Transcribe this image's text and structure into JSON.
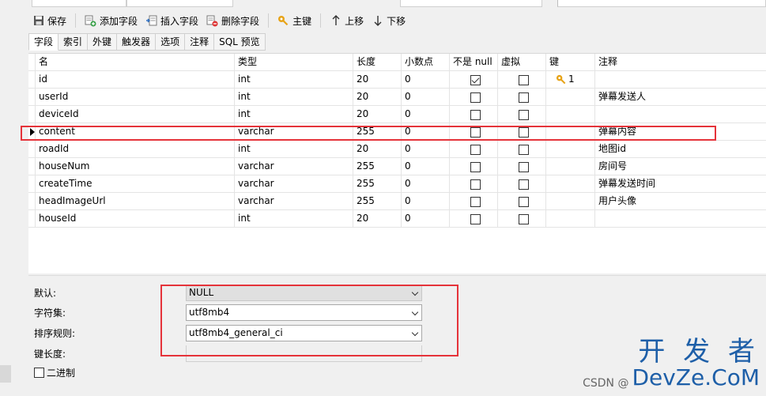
{
  "toolbar": {
    "save": "保存",
    "add_field": "添加字段",
    "insert_field": "插入字段",
    "delete_field": "删除字段",
    "primary_key": "主键",
    "move_up": "上移",
    "move_down": "下移"
  },
  "tabs": [
    "字段",
    "索引",
    "外键",
    "触发器",
    "选项",
    "注释",
    "SQL 预览"
  ],
  "grid": {
    "headers": [
      "名",
      "类型",
      "长度",
      "小数点",
      "不是 null",
      "虚拟",
      "键",
      "注释"
    ],
    "rows": [
      {
        "name": "id",
        "type": "int",
        "length": "20",
        "decimals": "0",
        "not_null": true,
        "virtual": false,
        "key": "1",
        "comment": ""
      },
      {
        "name": "userId",
        "type": "int",
        "length": "20",
        "decimals": "0",
        "not_null": false,
        "virtual": false,
        "key": "",
        "comment": "弹幕发送人"
      },
      {
        "name": "deviceId",
        "type": "int",
        "length": "20",
        "decimals": "0",
        "not_null": false,
        "virtual": false,
        "key": "",
        "comment": ""
      },
      {
        "name": "content",
        "type": "varchar",
        "length": "255",
        "decimals": "0",
        "not_null": false,
        "virtual": false,
        "key": "",
        "comment": "弹幕内容"
      },
      {
        "name": "roadId",
        "type": "int",
        "length": "20",
        "decimals": "0",
        "not_null": false,
        "virtual": false,
        "key": "",
        "comment": "地图id"
      },
      {
        "name": "houseNum",
        "type": "varchar",
        "length": "255",
        "decimals": "0",
        "not_null": false,
        "virtual": false,
        "key": "",
        "comment": "房间号"
      },
      {
        "name": "createTime",
        "type": "varchar",
        "length": "255",
        "decimals": "0",
        "not_null": false,
        "virtual": false,
        "key": "",
        "comment": "弹幕发送时间"
      },
      {
        "name": "headImageUrl",
        "type": "varchar",
        "length": "255",
        "decimals": "0",
        "not_null": false,
        "virtual": false,
        "key": "",
        "comment": "用户头像"
      },
      {
        "name": "houseId",
        "type": "int",
        "length": "20",
        "decimals": "0",
        "not_null": false,
        "virtual": false,
        "key": "",
        "comment": ""
      }
    ]
  },
  "properties": {
    "default_label": "默认:",
    "default_value": "NULL",
    "charset_label": "字符集:",
    "charset_value": "utf8mb4",
    "collation_label": "排序规则:",
    "collation_value": "utf8mb4_general_ci",
    "key_length_label": "键长度:",
    "binary_label": "二进制"
  },
  "watermark": {
    "big": "开 发 者",
    "small": "CSDN @",
    "brand": "DevZe.CoM"
  },
  "colors": {
    "highlight": "#e5333a",
    "brand": "#1e5fa8"
  }
}
